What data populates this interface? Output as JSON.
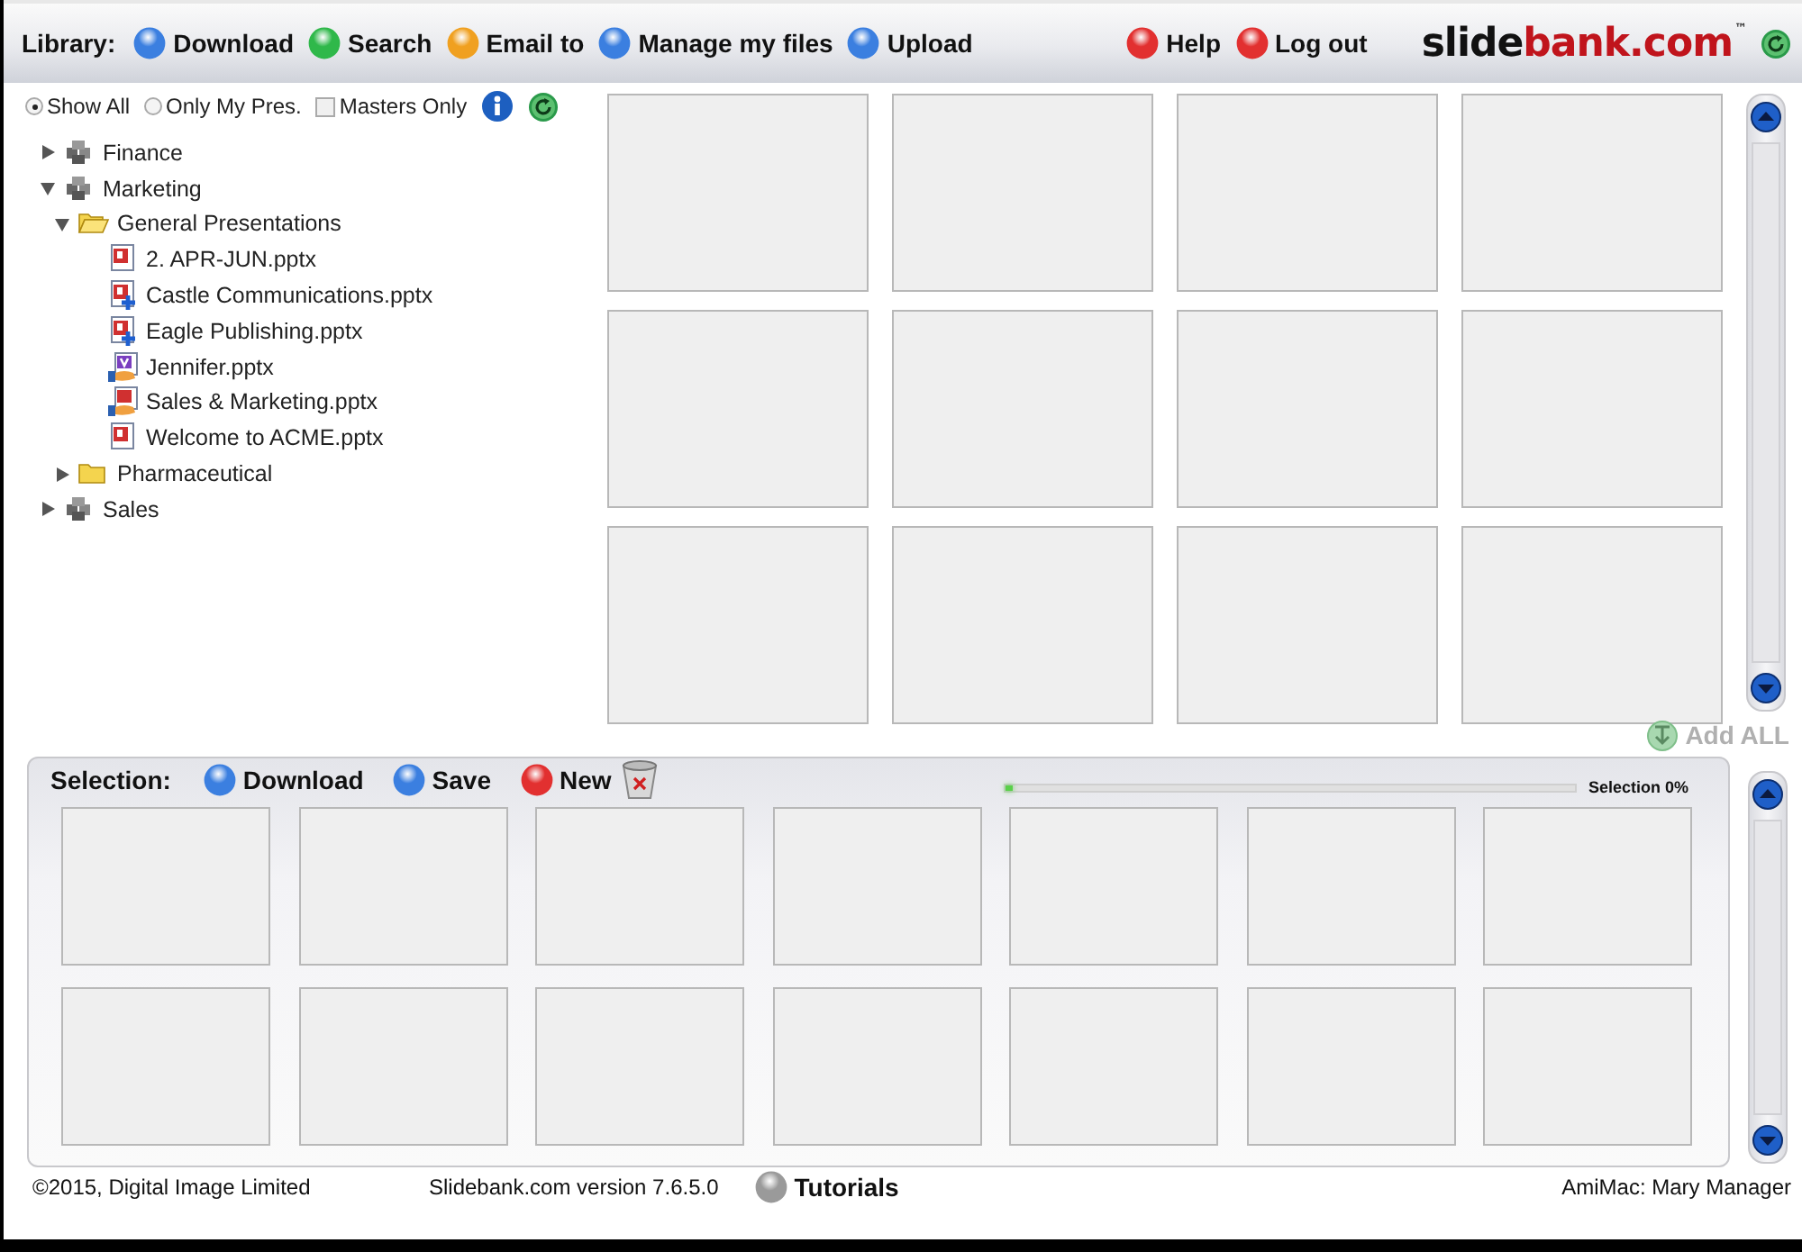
{
  "toolbar": {
    "label": "Library:",
    "buttons": [
      {
        "label": "Download",
        "color": "#3b7fe0"
      },
      {
        "label": "Search",
        "color": "#2fb84a"
      },
      {
        "label": "Email to",
        "color": "#f0a020"
      },
      {
        "label": "Manage my files",
        "color": "#3b7fe0"
      },
      {
        "label": "Upload",
        "color": "#3b7fe0"
      }
    ],
    "right_buttons": [
      {
        "label": "Help",
        "color": "#e23030"
      },
      {
        "label": "Log out",
        "color": "#e23030"
      }
    ],
    "logo": {
      "part_1": "slide",
      "part_2": "bank.com",
      "mark": "™"
    }
  },
  "filters": [
    {
      "kind": "radio",
      "label": "Show All",
      "selected": true
    },
    {
      "kind": "radio",
      "label": "Only My Pres.",
      "selected": false
    },
    {
      "kind": "checkbox",
      "label": "Masters Only",
      "checked": false
    }
  ],
  "tree": [
    {
      "kind": "group",
      "label": "Finance",
      "expanded": false
    },
    {
      "kind": "group",
      "label": "Marketing",
      "expanded": true,
      "children": [
        {
          "kind": "folder",
          "label": "General Presentations",
          "expanded": true,
          "children": [
            {
              "kind": "file",
              "label": "2. APR-JUN.pptx"
            },
            {
              "kind": "linked-file",
              "label": "Castle Communications.pptx"
            },
            {
              "kind": "linked-file",
              "label": "Eagle Publishing.pptx"
            },
            {
              "kind": "shared-video-file",
              "label": "Jennifer.pptx"
            },
            {
              "kind": "shared-file",
              "label": "Sales & Marketing.pptx"
            },
            {
              "kind": "file",
              "label": "Welcome to ACME.pptx"
            }
          ]
        },
        {
          "kind": "folder",
          "label": "Pharmaceutical",
          "expanded": false
        }
      ]
    },
    {
      "kind": "group",
      "label": "Sales",
      "expanded": false
    }
  ],
  "library_slots": [
    {
      "kind": "empty"
    },
    {
      "kind": "empty"
    },
    {
      "kind": "empty"
    },
    {
      "kind": "empty"
    },
    {
      "kind": "empty"
    },
    {
      "kind": "empty"
    },
    {
      "kind": "empty"
    },
    {
      "kind": "empty"
    },
    {
      "kind": "empty"
    },
    {
      "kind": "empty"
    },
    {
      "kind": "empty"
    },
    {
      "kind": "empty"
    }
  ],
  "add_all": {
    "label": "Add ALL",
    "disabled": true
  },
  "selection": {
    "label": "Selection:",
    "buttons": [
      {
        "label": "Download",
        "color": "#3b7fe0"
      },
      {
        "label": "Save",
        "color": "#3b7fe0"
      },
      {
        "label": "New",
        "color": "#e23030"
      }
    ],
    "progress": {
      "level": 0.01,
      "reading": "Selection 0%"
    },
    "slots": [
      {
        "kind": "empty"
      },
      {
        "kind": "empty"
      },
      {
        "kind": "empty"
      },
      {
        "kind": "empty"
      },
      {
        "kind": "empty"
      },
      {
        "kind": "empty"
      },
      {
        "kind": "empty"
      },
      {
        "kind": "empty"
      },
      {
        "kind": "empty"
      },
      {
        "kind": "empty"
      },
      {
        "kind": "empty"
      },
      {
        "kind": "empty"
      },
      {
        "kind": "empty"
      },
      {
        "kind": "empty"
      }
    ]
  },
  "footer": {
    "copyright": "©2015, Digital Image Limited",
    "version": "Slidebank.com version 7.6.5.0",
    "tutorials": {
      "label": "Tutorials",
      "color": "#9a9a9a"
    },
    "user": "AmiMac: Mary Manager"
  }
}
